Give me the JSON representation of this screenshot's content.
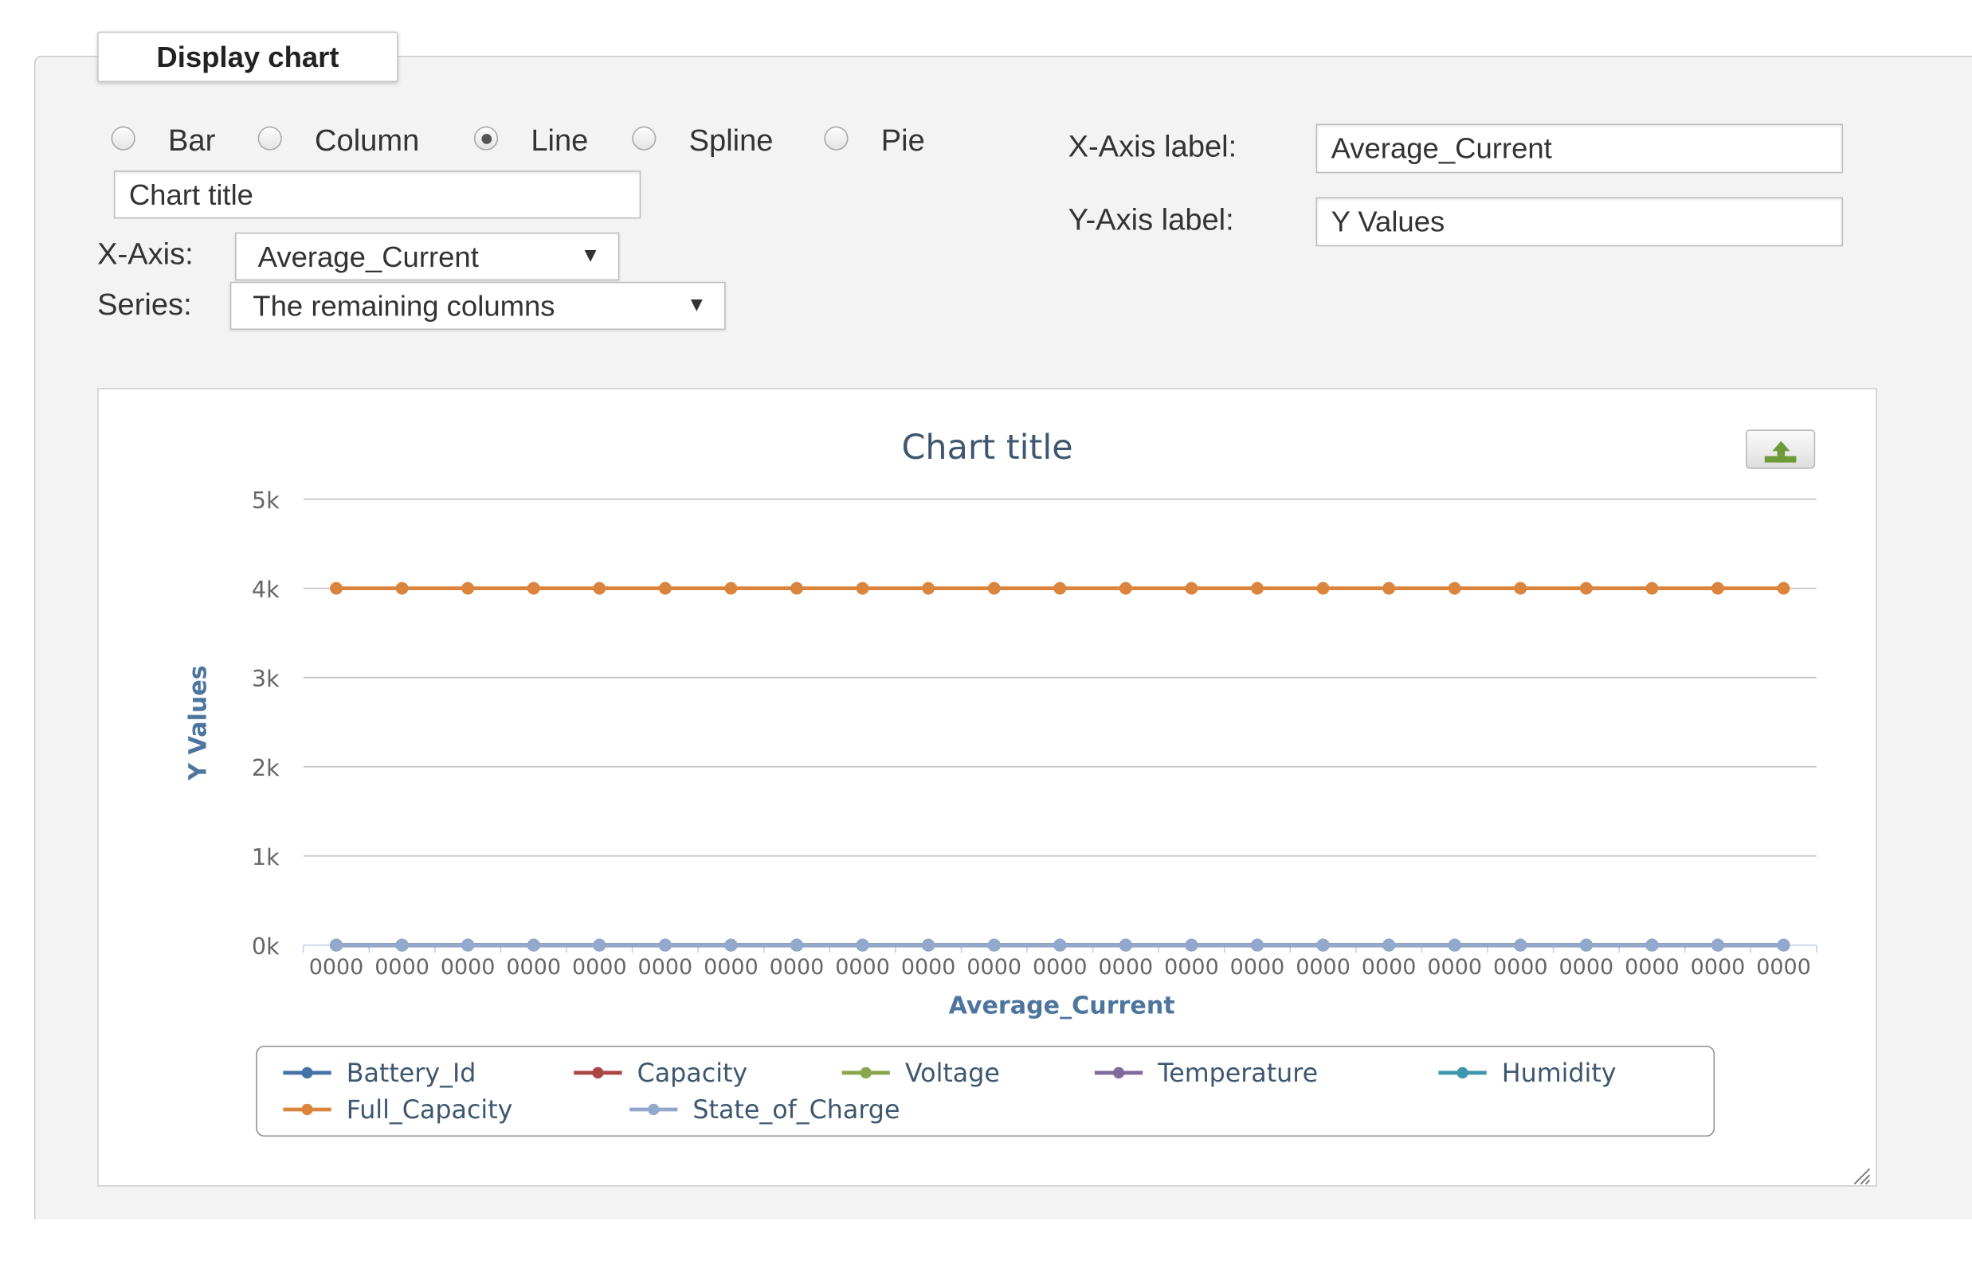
{
  "fieldset": {
    "legend": "Display chart"
  },
  "chart_type_options": [
    {
      "label": "Bar",
      "checked": false
    },
    {
      "label": "Column",
      "checked": false
    },
    {
      "label": "Line",
      "checked": true
    },
    {
      "label": "Spline",
      "checked": false
    },
    {
      "label": "Pie",
      "checked": false
    }
  ],
  "chart_title_input": {
    "value": "Chart title"
  },
  "x_axis_select": {
    "label": "X-Axis:",
    "value": "Average_Current"
  },
  "series_select": {
    "label": "Series:",
    "value": "The remaining columns"
  },
  "x_axis_label_field": {
    "label": "X-Axis label:",
    "value": "Average_Current"
  },
  "y_axis_label_field": {
    "label": "Y-Axis label:",
    "value": "Y Values"
  },
  "export_icon": "download-icon",
  "chart_data": {
    "type": "line",
    "title": "Chart title",
    "xlabel": "Average_Current",
    "ylabel": "Y Values",
    "ylim": [
      0,
      5000
    ],
    "yticks": [
      "0k",
      "1k",
      "2k",
      "3k",
      "4k",
      "5k"
    ],
    "x": [
      "0000",
      "0000",
      "0000",
      "0000",
      "0000",
      "0000",
      "0000",
      "0000",
      "0000",
      "0000",
      "0000",
      "0000",
      "0000",
      "0000",
      "0000",
      "0000",
      "0000",
      "0000",
      "0000",
      "0000",
      "0000",
      "0000",
      "0000"
    ],
    "grid": true,
    "legend_position": "bottom",
    "series": [
      {
        "name": "Battery_Id",
        "color": "#4572A7",
        "values": [
          0,
          0,
          0,
          0,
          0,
          0,
          0,
          0,
          0,
          0,
          0,
          0,
          0,
          0,
          0,
          0,
          0,
          0,
          0,
          0,
          0,
          0,
          0
        ]
      },
      {
        "name": "Capacity",
        "color": "#AA4643",
        "values": [
          0,
          0,
          0,
          0,
          0,
          0,
          0,
          0,
          0,
          0,
          0,
          0,
          0,
          0,
          0,
          0,
          0,
          0,
          0,
          0,
          0,
          0,
          0
        ]
      },
      {
        "name": "Voltage",
        "color": "#89A54E",
        "values": [
          0,
          0,
          0,
          0,
          0,
          0,
          0,
          0,
          0,
          0,
          0,
          0,
          0,
          0,
          0,
          0,
          0,
          0,
          0,
          0,
          0,
          0,
          0
        ]
      },
      {
        "name": "Temperature",
        "color": "#80699B",
        "values": [
          0,
          0,
          0,
          0,
          0,
          0,
          0,
          0,
          0,
          0,
          0,
          0,
          0,
          0,
          0,
          0,
          0,
          0,
          0,
          0,
          0,
          0,
          0
        ]
      },
      {
        "name": "Humidity",
        "color": "#3D96AE",
        "values": [
          0,
          0,
          0,
          0,
          0,
          0,
          0,
          0,
          0,
          0,
          0,
          0,
          0,
          0,
          0,
          0,
          0,
          0,
          0,
          0,
          0,
          0,
          0
        ]
      },
      {
        "name": "Full_Capacity",
        "color": "#DB843D",
        "values": [
          4000,
          4000,
          4000,
          4000,
          4000,
          4000,
          4000,
          4000,
          4000,
          4000,
          4000,
          4000,
          4000,
          4000,
          4000,
          4000,
          4000,
          4000,
          4000,
          4000,
          4000,
          4000,
          4000
        ]
      },
      {
        "name": "State_of_Charge",
        "color": "#92A8CD",
        "values": [
          0,
          0,
          0,
          0,
          0,
          0,
          0,
          0,
          0,
          0,
          0,
          0,
          0,
          0,
          0,
          0,
          0,
          0,
          0,
          0,
          0,
          0,
          0
        ]
      }
    ]
  }
}
